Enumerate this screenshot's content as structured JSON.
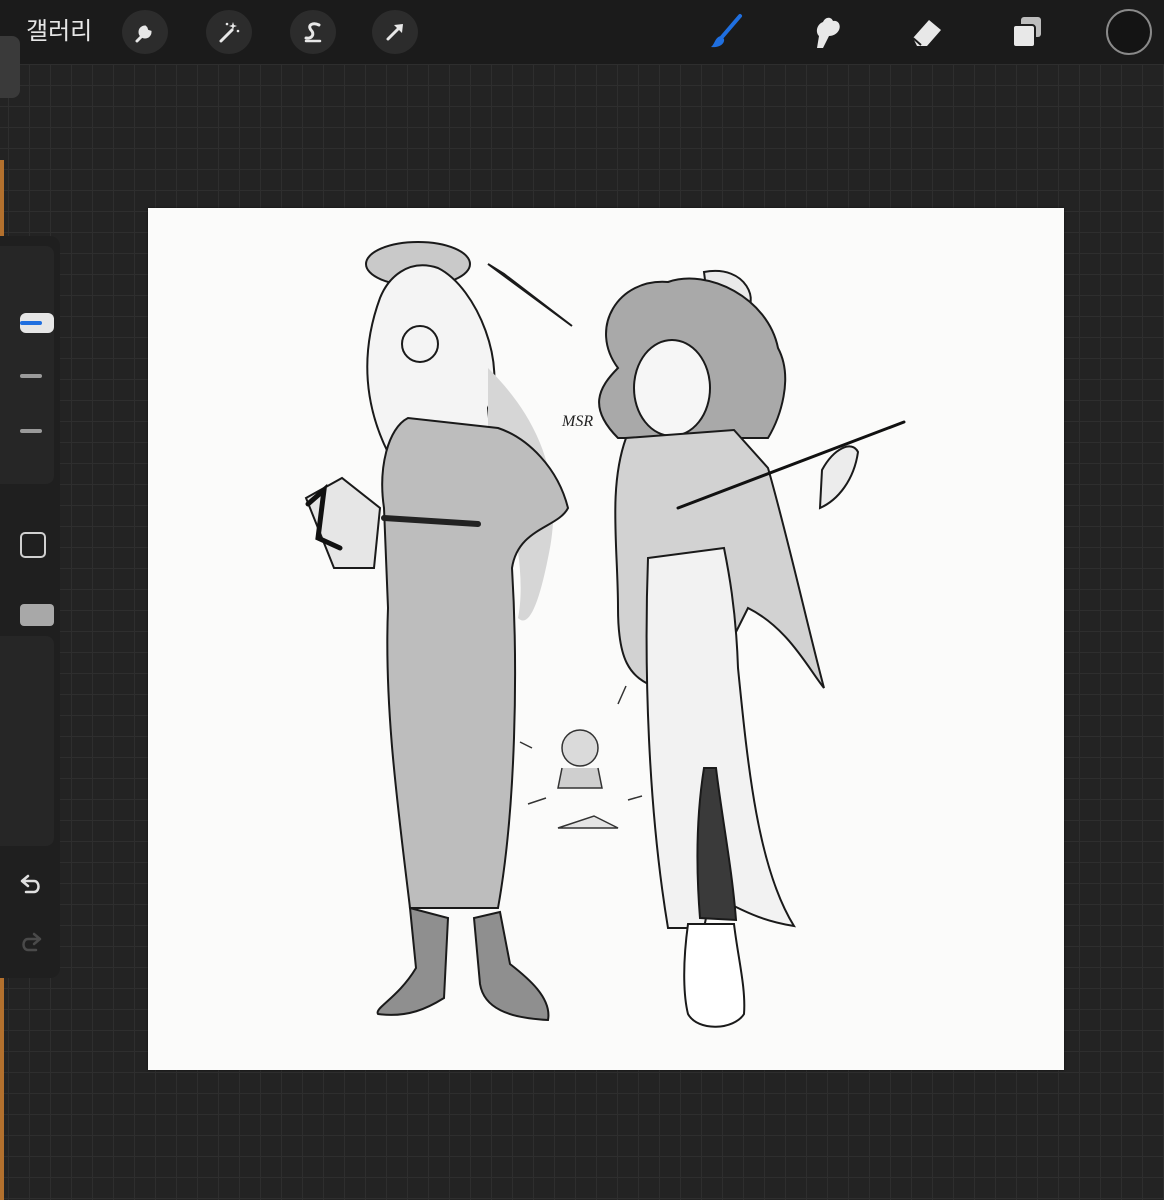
{
  "topbar": {
    "gallery_label": "갤러리",
    "left_tools": [
      {
        "name": "actions",
        "icon": "wrench-icon"
      },
      {
        "name": "adjustments",
        "icon": "magic-wand-icon"
      },
      {
        "name": "selection",
        "icon": "selection-s-icon"
      },
      {
        "name": "transform",
        "icon": "transform-arrow-icon"
      }
    ],
    "right_tools": [
      {
        "name": "brush",
        "icon": "brush-icon",
        "active": true
      },
      {
        "name": "smudge",
        "icon": "smudge-icon"
      },
      {
        "name": "eraser",
        "icon": "eraser-icon"
      },
      {
        "name": "layers",
        "icon": "layers-icon"
      }
    ],
    "current_color": "#141414",
    "active_color": "#1f6fe0"
  },
  "sidebar": {
    "brush_size_level": 0.15,
    "opacity_level": 0.2,
    "buttons": [
      "modify-square-icon",
      "eyedropper-square-icon",
      "undo-icon",
      "redo-icon"
    ]
  },
  "canvas": {
    "signature": "MSR"
  }
}
